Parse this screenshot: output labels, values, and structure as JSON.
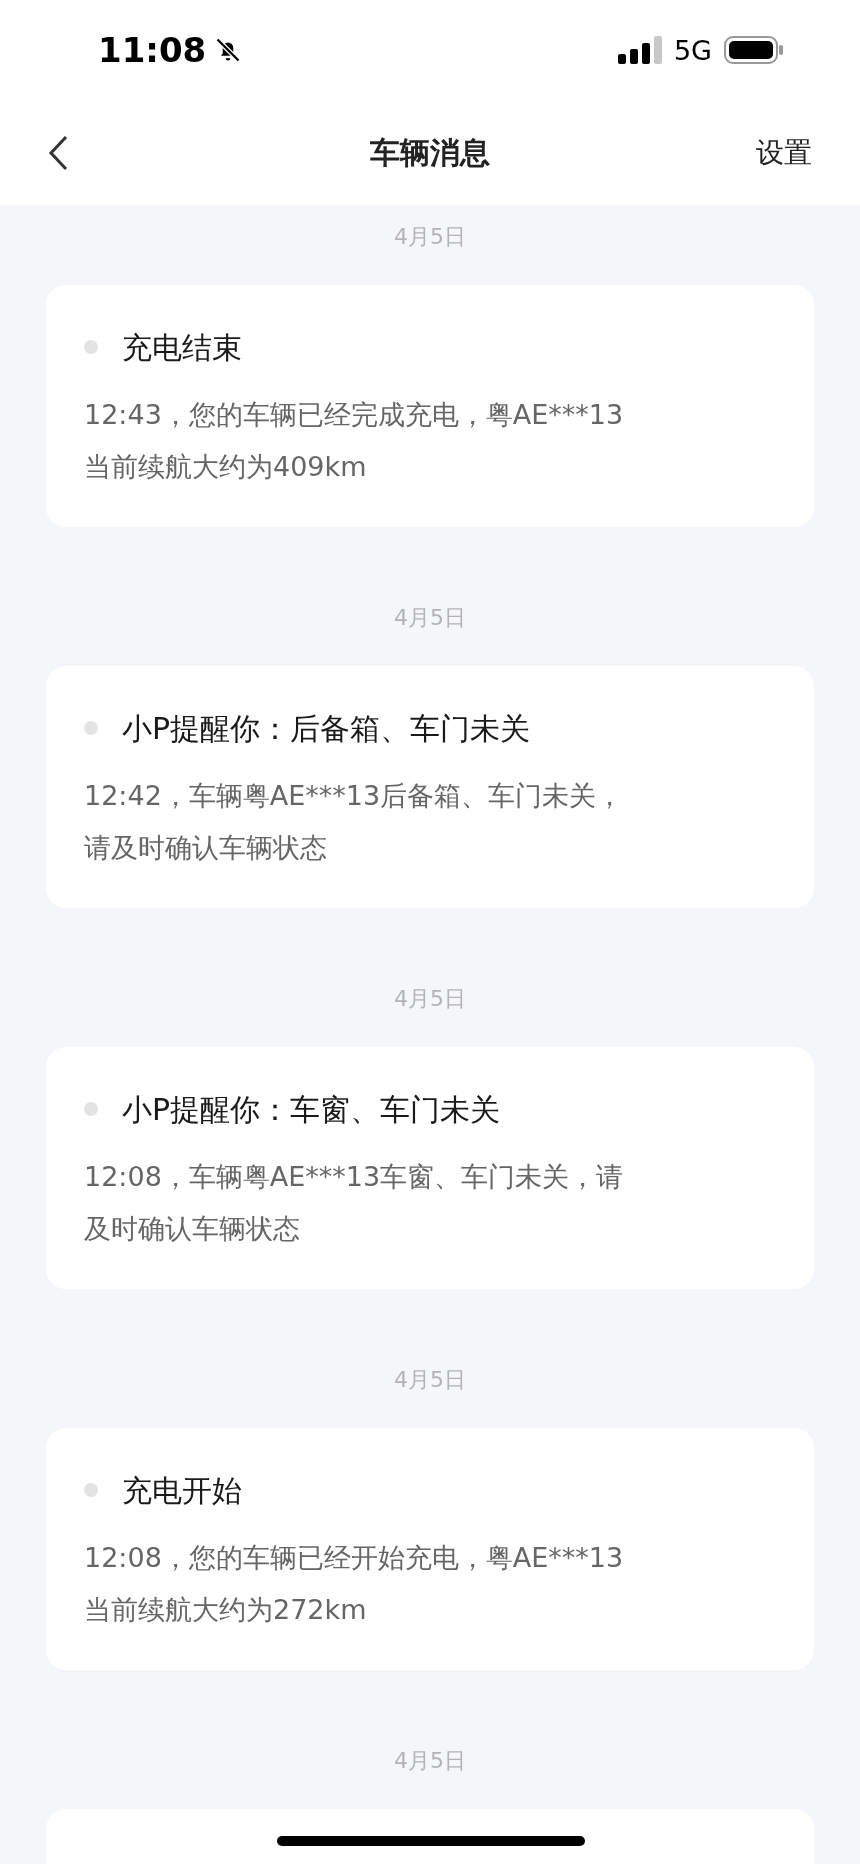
{
  "status_bar": {
    "time": "11:08",
    "network": "5G"
  },
  "header": {
    "title": "车辆消息",
    "action": "设置"
  },
  "messages": [
    {
      "date": "4月5日",
      "title": "充电结束",
      "lines": [
        "12:43，您的车辆已经完成充电，粤AE***13",
        "当前续航大约为409km"
      ]
    },
    {
      "date": "4月5日",
      "title": "小P提醒你：后备箱、车门未关",
      "lines": [
        "12:42，车辆粤AE***13后备箱、车门未关，",
        "请及时确认车辆状态"
      ]
    },
    {
      "date": "4月5日",
      "title": "小P提醒你：车窗、车门未关",
      "lines": [
        "12:08，车辆粤AE***13车窗、车门未关，请",
        "及时确认车辆状态"
      ]
    },
    {
      "date": "4月5日",
      "title": "充电开始",
      "lines": [
        "12:08，您的车辆已经开始充电，粤AE***13",
        "当前续航大约为272km"
      ]
    },
    {
      "date": "4月5日"
    }
  ]
}
